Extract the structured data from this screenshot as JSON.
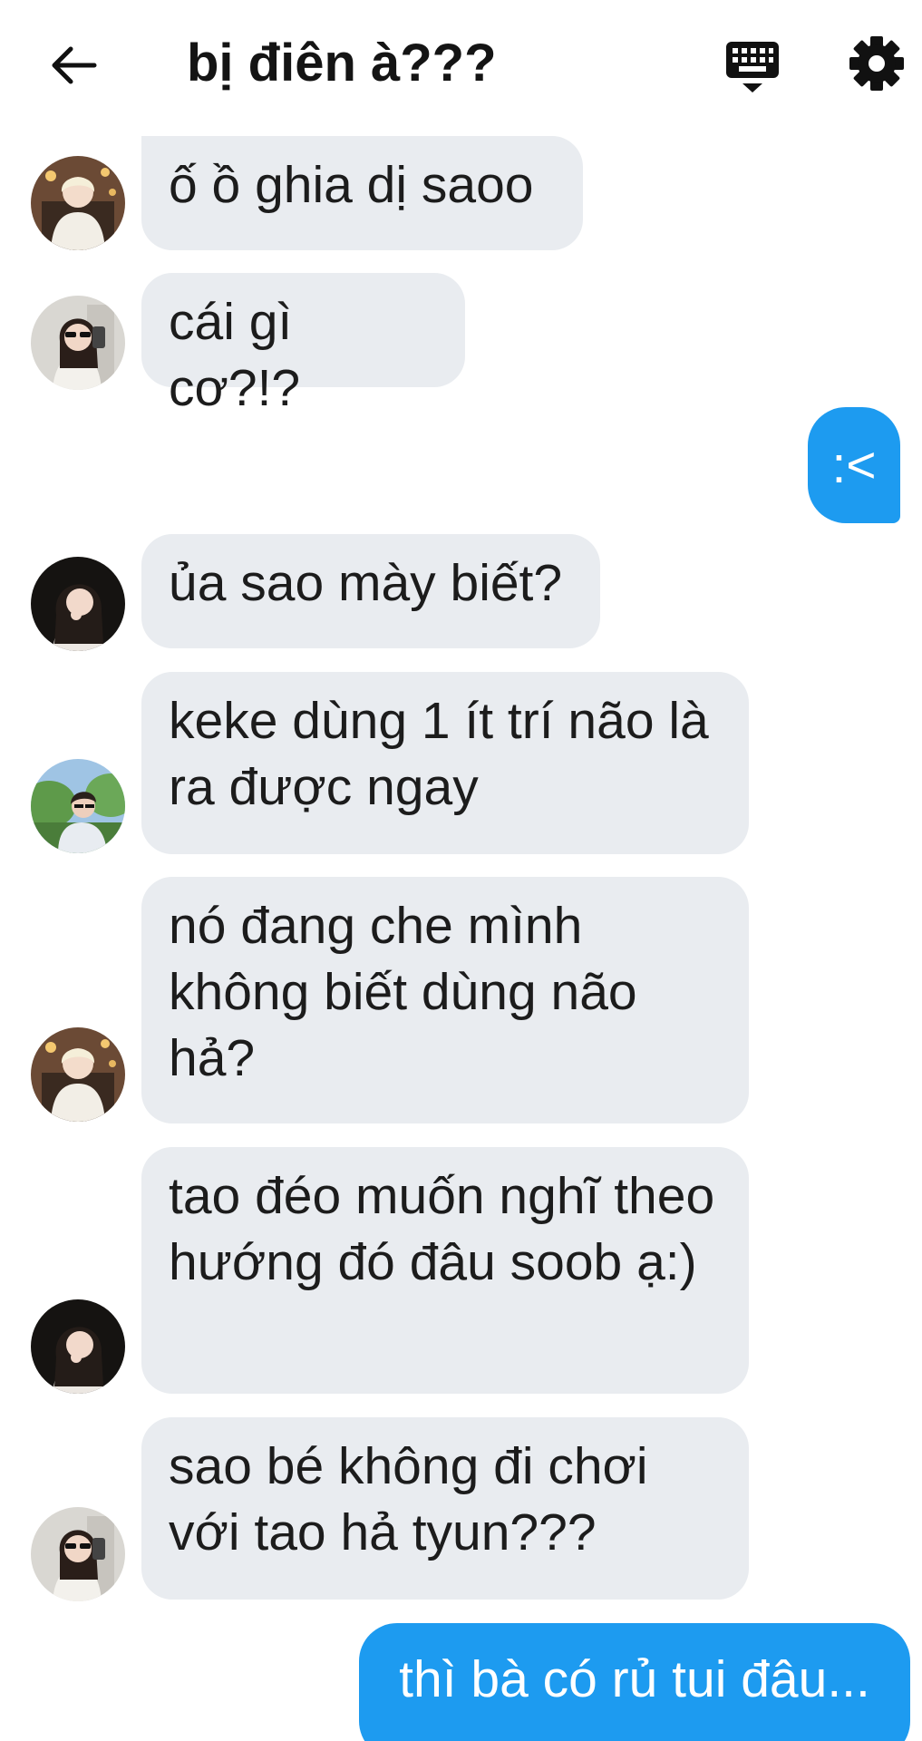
{
  "header": {
    "title": "bị điên à???",
    "back_icon": "arrow-left-icon",
    "keyboard_icon": "keyboard-icon",
    "settings_icon": "gear-icon"
  },
  "colors": {
    "incoming_bubble": "#e9ecf0",
    "outgoing_bubble": "#1d9bf0",
    "text": "#1c1c1c"
  },
  "messages": [
    {
      "direction": "in",
      "avatar": "avatar-blonde-girl",
      "text": "ố ồ ghia dị saoo"
    },
    {
      "direction": "in",
      "avatar": "avatar-girl-sunglasses",
      "text": "cái gì cơ?!?"
    },
    {
      "direction": "out",
      "text": ":<"
    },
    {
      "direction": "in",
      "avatar": "avatar-girl-dark-hair",
      "text": "ủa sao mày biết?"
    },
    {
      "direction": "in",
      "avatar": "avatar-boy-outdoor",
      "text": "keke dùng 1 ít trí não là ra được ngay"
    },
    {
      "direction": "in",
      "avatar": "avatar-blonde-girl",
      "text": "nó đang che mình không biết dùng não hả?"
    },
    {
      "direction": "in",
      "avatar": "avatar-girl-dark-hair",
      "text": "tao đéo muốn nghĩ theo hướng đó đâu soob ạ:)"
    },
    {
      "direction": "in",
      "avatar": "avatar-girl-sunglasses",
      "text": "sao bé không đi chơi với tao hả tyun???"
    },
    {
      "direction": "out",
      "text": "thì bà có rủ tui đâu..."
    }
  ]
}
